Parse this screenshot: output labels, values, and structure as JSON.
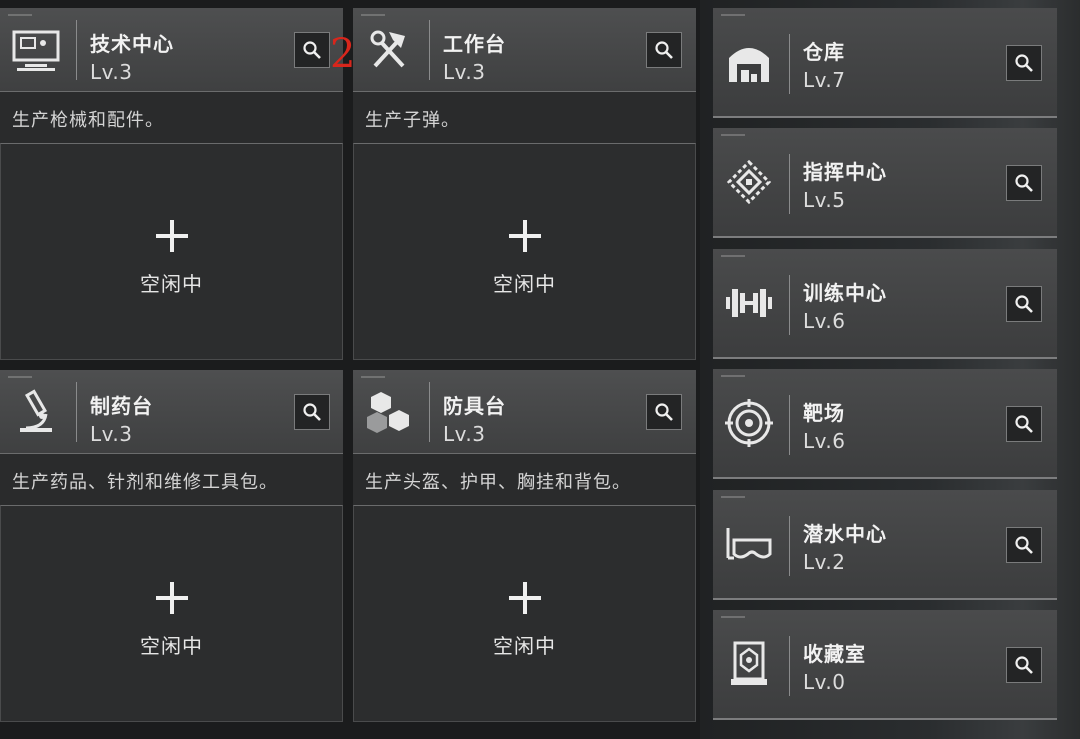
{
  "idle_label": "空闲中",
  "marker": "2",
  "stations": [
    {
      "name": "技术中心",
      "level": "Lv.3",
      "desc": "生产枪械和配件。",
      "icon": "computer-icon"
    },
    {
      "name": "工作台",
      "level": "Lv.3",
      "desc": "生产子弹。",
      "icon": "hammer-wrench-icon"
    },
    {
      "name": "制药台",
      "level": "Lv.3",
      "desc": "生产药品、针剂和维修工具包。",
      "icon": "microscope-icon"
    },
    {
      "name": "防具台",
      "level": "Lv.3",
      "desc": "生产头盔、护甲、胸挂和背包。",
      "icon": "cubes-icon"
    }
  ],
  "facilities": [
    {
      "name": "仓库",
      "level": "Lv.7",
      "icon": "warehouse-icon"
    },
    {
      "name": "指挥中心",
      "level": "Lv.5",
      "icon": "command-chip-icon"
    },
    {
      "name": "训练中心",
      "level": "Lv.6",
      "icon": "dumbbell-icon"
    },
    {
      "name": "靶场",
      "level": "Lv.6",
      "icon": "target-icon"
    },
    {
      "name": "潜水中心",
      "level": "Lv.2",
      "icon": "diving-mask-icon"
    },
    {
      "name": "收藏室",
      "level": "Lv.0",
      "icon": "display-case-icon"
    }
  ],
  "colors": {
    "accent_marker": "#d8261c",
    "panel": "#2a2b2c",
    "header": "#4a4b4c"
  }
}
